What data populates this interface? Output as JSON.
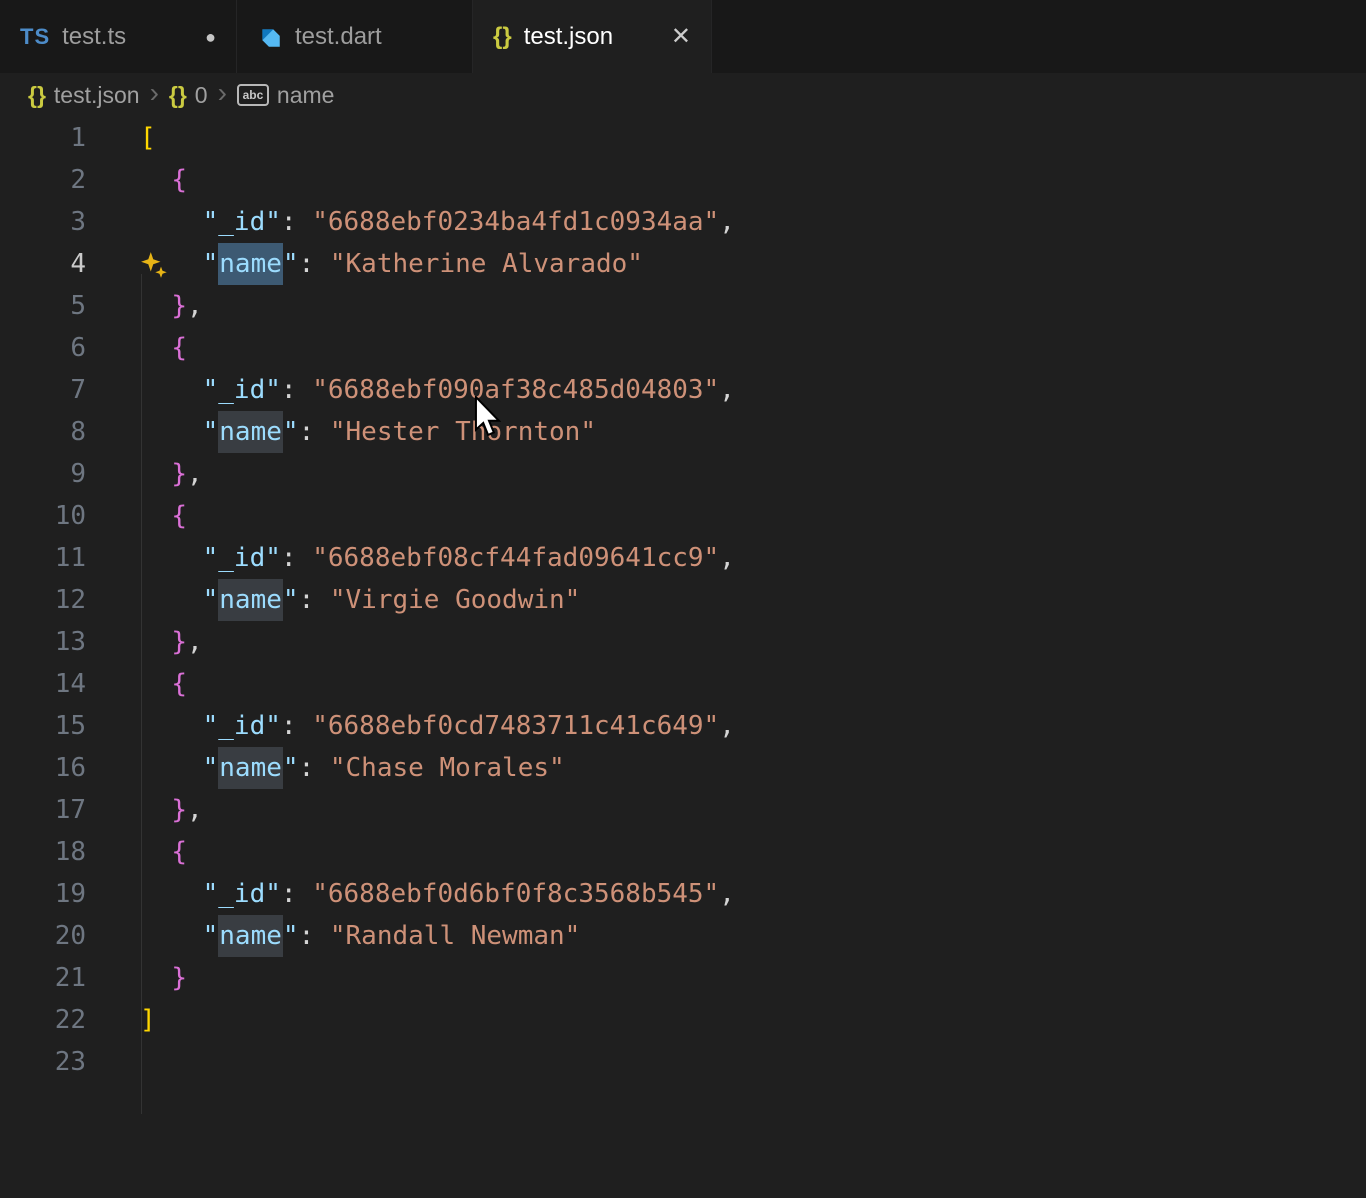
{
  "colors": {
    "editor_bg": "#1f1f1f",
    "tabbar_bg": "#181818",
    "key_color": "#9cdcfe",
    "string_color": "#ce9178",
    "square_bracket_color": "#ffd700",
    "curly_bracket_color": "#da70d6",
    "selection_highlight": "#3d5a73",
    "word_highlight": "#393d42",
    "sparkle_color": "#e7b416"
  },
  "ui": {
    "close_glyph": "✕",
    "modified_dot": "●",
    "ts_icon_text": "TS",
    "json_icon_text": "{}"
  },
  "tabs": [
    {
      "label": "test.ts",
      "icon": "typescript-icon",
      "modified": true,
      "active": false
    },
    {
      "label": "test.dart",
      "icon": "dart-icon",
      "modified": false,
      "active": false
    },
    {
      "label": "test.json",
      "icon": "json-icon",
      "modified": false,
      "active": true
    }
  ],
  "breadcrumb": {
    "separator": "›",
    "items": [
      {
        "label": "test.json",
        "icon": "json-braces-icon",
        "icon_text": "{}"
      },
      {
        "label": "0",
        "icon": "object-braces-icon",
        "icon_text": "{}"
      },
      {
        "label": "name",
        "icon": "symbol-string-icon",
        "icon_text": "abc"
      }
    ]
  },
  "editor": {
    "active_line": 4,
    "sparkle_line": 4,
    "lines": [
      {
        "n": 1,
        "tk": [
          {
            "t": "[",
            "c": "b1"
          }
        ]
      },
      {
        "n": 2,
        "tk": [
          {
            "t": "  "
          },
          {
            "t": "{",
            "c": "b2"
          }
        ]
      },
      {
        "n": 3,
        "tk": [
          {
            "t": "    "
          },
          {
            "t": "\"_id\"",
            "c": "k"
          },
          {
            "t": ": ",
            "c": "p"
          },
          {
            "t": "\"6688ebf0234ba4fd1c0934aa\"",
            "c": "s"
          },
          {
            "t": ",",
            "c": "p"
          }
        ]
      },
      {
        "n": 4,
        "tk": [
          {
            "t": "    "
          },
          {
            "t": "\"",
            "c": "k"
          },
          {
            "t": "name",
            "c": "kh"
          },
          {
            "t": "\"",
            "c": "k"
          },
          {
            "t": ": ",
            "c": "p"
          },
          {
            "t": "\"Katherine Alvarado\"",
            "c": "s"
          }
        ]
      },
      {
        "n": 5,
        "tk": [
          {
            "t": "  "
          },
          {
            "t": "}",
            "c": "b2"
          },
          {
            "t": ",",
            "c": "p"
          }
        ]
      },
      {
        "n": 6,
        "tk": [
          {
            "t": "  "
          },
          {
            "t": "{",
            "c": "b2"
          }
        ]
      },
      {
        "n": 7,
        "tk": [
          {
            "t": "    "
          },
          {
            "t": "\"_id\"",
            "c": "k"
          },
          {
            "t": ": ",
            "c": "p"
          },
          {
            "t": "\"6688ebf090af38c485d04803\"",
            "c": "s"
          },
          {
            "t": ",",
            "c": "p"
          }
        ]
      },
      {
        "n": 8,
        "tk": [
          {
            "t": "    "
          },
          {
            "t": "\"",
            "c": "k"
          },
          {
            "t": "name",
            "c": "kw"
          },
          {
            "t": "\"",
            "c": "k"
          },
          {
            "t": ": ",
            "c": "p"
          },
          {
            "t": "\"Hester Thornton\"",
            "c": "s"
          }
        ]
      },
      {
        "n": 9,
        "tk": [
          {
            "t": "  "
          },
          {
            "t": "}",
            "c": "b2"
          },
          {
            "t": ",",
            "c": "p"
          }
        ]
      },
      {
        "n": 10,
        "tk": [
          {
            "t": "  "
          },
          {
            "t": "{",
            "c": "b2"
          }
        ]
      },
      {
        "n": 11,
        "tk": [
          {
            "t": "    "
          },
          {
            "t": "\"_id\"",
            "c": "k"
          },
          {
            "t": ": ",
            "c": "p"
          },
          {
            "t": "\"6688ebf08cf44fad09641cc9\"",
            "c": "s"
          },
          {
            "t": ",",
            "c": "p"
          }
        ]
      },
      {
        "n": 12,
        "tk": [
          {
            "t": "    "
          },
          {
            "t": "\"",
            "c": "k"
          },
          {
            "t": "name",
            "c": "kw"
          },
          {
            "t": "\"",
            "c": "k"
          },
          {
            "t": ": ",
            "c": "p"
          },
          {
            "t": "\"Virgie Goodwin\"",
            "c": "s"
          }
        ]
      },
      {
        "n": 13,
        "tk": [
          {
            "t": "  "
          },
          {
            "t": "}",
            "c": "b2"
          },
          {
            "t": ",",
            "c": "p"
          }
        ]
      },
      {
        "n": 14,
        "tk": [
          {
            "t": "  "
          },
          {
            "t": "{",
            "c": "b2"
          }
        ]
      },
      {
        "n": 15,
        "tk": [
          {
            "t": "    "
          },
          {
            "t": "\"_id\"",
            "c": "k"
          },
          {
            "t": ": ",
            "c": "p"
          },
          {
            "t": "\"6688ebf0cd7483711c41c649\"",
            "c": "s"
          },
          {
            "t": ",",
            "c": "p"
          }
        ]
      },
      {
        "n": 16,
        "tk": [
          {
            "t": "    "
          },
          {
            "t": "\"",
            "c": "k"
          },
          {
            "t": "name",
            "c": "kw"
          },
          {
            "t": "\"",
            "c": "k"
          },
          {
            "t": ": ",
            "c": "p"
          },
          {
            "t": "\"Chase Morales\"",
            "c": "s"
          }
        ]
      },
      {
        "n": 17,
        "tk": [
          {
            "t": "  "
          },
          {
            "t": "}",
            "c": "b2"
          },
          {
            "t": ",",
            "c": "p"
          }
        ]
      },
      {
        "n": 18,
        "tk": [
          {
            "t": "  "
          },
          {
            "t": "{",
            "c": "b2"
          }
        ]
      },
      {
        "n": 19,
        "tk": [
          {
            "t": "    "
          },
          {
            "t": "\"_id\"",
            "c": "k"
          },
          {
            "t": ": ",
            "c": "p"
          },
          {
            "t": "\"6688ebf0d6bf0f8c3568b545\"",
            "c": "s"
          },
          {
            "t": ",",
            "c": "p"
          }
        ]
      },
      {
        "n": 20,
        "tk": [
          {
            "t": "    "
          },
          {
            "t": "\"",
            "c": "k"
          },
          {
            "t": "name",
            "c": "kw"
          },
          {
            "t": "\"",
            "c": "k"
          },
          {
            "t": ": ",
            "c": "p"
          },
          {
            "t": "\"Randall Newman\"",
            "c": "s"
          }
        ]
      },
      {
        "n": 21,
        "tk": [
          {
            "t": "  "
          },
          {
            "t": "}",
            "c": "b2"
          }
        ]
      },
      {
        "n": 22,
        "tk": [
          {
            "t": "]",
            "c": "b1"
          }
        ]
      },
      {
        "n": 23,
        "tk": []
      }
    ]
  }
}
